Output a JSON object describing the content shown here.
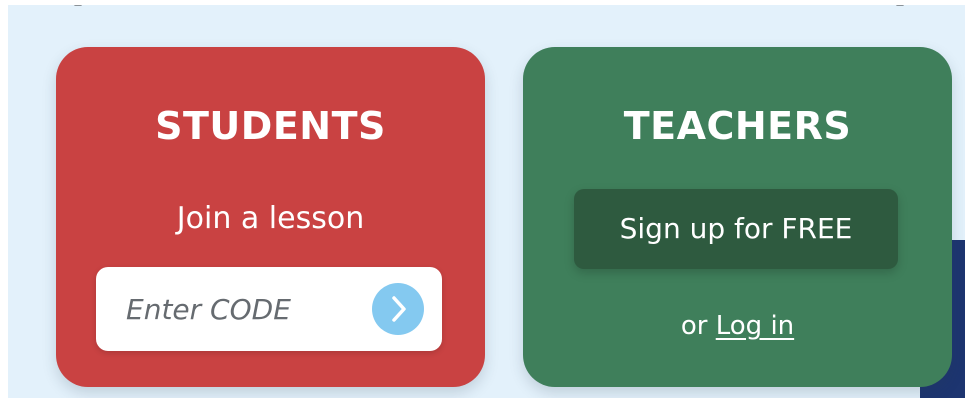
{
  "students": {
    "title": "STUDENTS",
    "subtitle": "Join a lesson",
    "code_placeholder": "Enter CODE",
    "go_icon": "chevron-right-icon",
    "background_color": "#c94242"
  },
  "teachers": {
    "title": "TEACHERS",
    "signup_label": "Sign up for FREE",
    "login_prefix": "or",
    "login_label": "Log in",
    "background_color": "#3f7f5b",
    "button_color": "#2e5a3f"
  },
  "colors": {
    "page_background": "#e3f1fb",
    "go_button": "#84c9f0",
    "accent_navy": "#1d3570"
  }
}
